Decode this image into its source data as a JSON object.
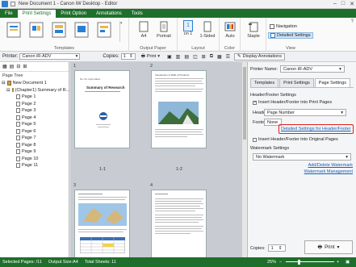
{
  "window": {
    "title": "New Document 1 - Canon iW Desktop - Editor"
  },
  "ribbon": {
    "tabs": [
      "File",
      "Print Settings",
      "Print Option",
      "Annotations",
      "Tools"
    ],
    "active_tab": "Print Settings",
    "groups": {
      "templates": "Templates",
      "output_paper": "Output Paper",
      "layout": "Layout",
      "color": "Color",
      "view": "View"
    },
    "buttons": {
      "paper_size": "A4",
      "orientation": "Portrait",
      "pages_per_sheet_num": "1",
      "pages_per_sheet": "on 1",
      "sided": "1-Sided",
      "color_mode": "Auto",
      "staple": "Staple",
      "navigation": "Navigation",
      "detailed_settings": "Detailed Settings"
    }
  },
  "toolbar": {
    "printer_label": "Printer:",
    "printer_value": "Canon iR-ADV",
    "copies_label": "Copies:",
    "copies_value": "1",
    "print_label": "Print",
    "display_annotations": "Display Annotations"
  },
  "left_pane": {
    "title": "Page Tree",
    "root": "New Document 1",
    "chapter": "(Chapter1) Summary of R...",
    "pages": [
      "Page 1",
      "Page 2",
      "Page 3",
      "Page 4",
      "Page 5",
      "Page 6",
      "Page 7",
      "Page 8",
      "Page 9",
      "Page 10",
      "Page 11"
    ]
  },
  "doc": {
    "page_numbers": [
      "1",
      "2",
      "3",
      "4"
    ],
    "sheet_labels": [
      "1-1",
      "1-2"
    ],
    "p1_title": "Summary of Research"
  },
  "right_pane": {
    "printer_name_label": "Printer Name:",
    "printer_name_value": "Canon iR-ADV",
    "tabs": [
      "Templates",
      "Print Settings",
      "Page Settings"
    ],
    "active_tab": "Page Settings",
    "header_footer_title": "Header/Footer Settings",
    "insert_hf_label": "Insert Header/Footer into Print Pages",
    "header_label": "Header",
    "header_value": "Page Number",
    "footer_label": "Footer",
    "footer_value": "None",
    "detailed_link": "Detailed Settings for Header/Footer",
    "insert_original_label": "Insert Header/Footer into Original Pages",
    "watermark_title": "Watermark Settings",
    "watermark_value": "No Watermark",
    "add_delete_link": "Add/Delete Watermark",
    "management_link": "Watermark Management",
    "copies_label": "Copies:",
    "copies_value": "1",
    "print_button": "Print"
  },
  "statusbar": {
    "selected_pages": "Selected Pages: /11",
    "output_size": "Output Size:A4",
    "total_sheets": "Total Sheets: 11",
    "zoom": "25%"
  },
  "colors": {
    "ribbon_green": "#1f6f2c",
    "highlight_red": "#e02020",
    "link_blue": "#1a5fb4"
  }
}
